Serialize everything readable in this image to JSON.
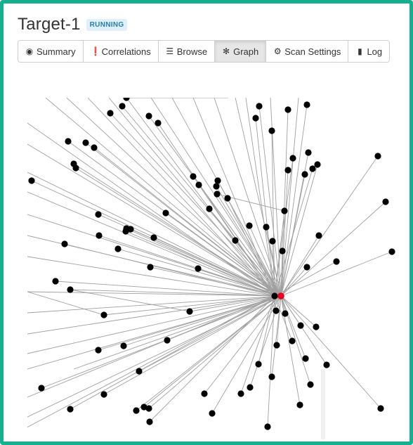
{
  "header": {
    "title": "Target-1",
    "status": "RUNNING"
  },
  "tabs": [
    {
      "label": "Summary",
      "icon": "eye-icon",
      "glyph": "◉",
      "active": false
    },
    {
      "label": "Correlations",
      "icon": "exclamation-circle-icon",
      "glyph": "❗",
      "active": false
    },
    {
      "label": "Browse",
      "icon": "list-icon",
      "glyph": "☰",
      "active": false
    },
    {
      "label": "Graph",
      "icon": "asterisk-icon",
      "glyph": "✻",
      "active": true
    },
    {
      "label": "Scan Settings",
      "icon": "gear-icon",
      "glyph": "⚙",
      "active": false
    },
    {
      "label": "Log",
      "icon": "book-icon",
      "glyph": "▮",
      "active": false
    }
  ],
  "colors": {
    "accent": "#16b08f",
    "node": "#000000",
    "root_node": "#e8001c",
    "edge": "#a0a0a0",
    "badge_text": "#2a7fb0"
  },
  "graph": {
    "root_node_color": "red",
    "node_color": "black"
  }
}
